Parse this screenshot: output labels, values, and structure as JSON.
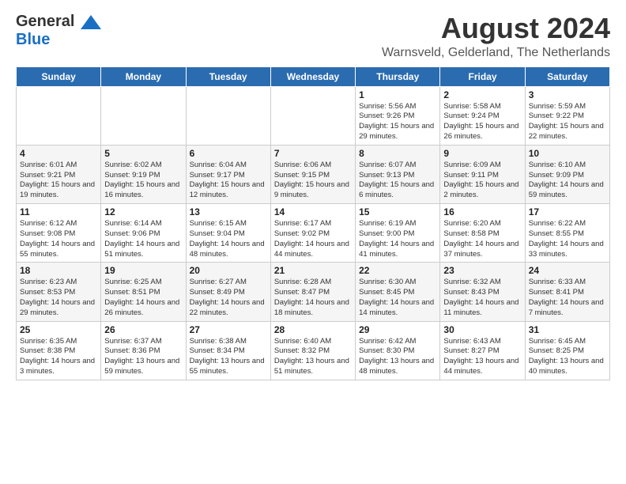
{
  "header": {
    "logo_line1": "General",
    "logo_line2": "Blue",
    "title": "August 2024",
    "subtitle": "Warnsveld, Gelderland, The Netherlands"
  },
  "days_of_week": [
    "Sunday",
    "Monday",
    "Tuesday",
    "Wednesday",
    "Thursday",
    "Friday",
    "Saturday"
  ],
  "weeks": [
    [
      {
        "day": "",
        "info": ""
      },
      {
        "day": "",
        "info": ""
      },
      {
        "day": "",
        "info": ""
      },
      {
        "day": "",
        "info": ""
      },
      {
        "day": "1",
        "info": "Sunrise: 5:56 AM\nSunset: 9:26 PM\nDaylight: 15 hours and 29 minutes."
      },
      {
        "day": "2",
        "info": "Sunrise: 5:58 AM\nSunset: 9:24 PM\nDaylight: 15 hours and 26 minutes."
      },
      {
        "day": "3",
        "info": "Sunrise: 5:59 AM\nSunset: 9:22 PM\nDaylight: 15 hours and 22 minutes."
      }
    ],
    [
      {
        "day": "4",
        "info": "Sunrise: 6:01 AM\nSunset: 9:21 PM\nDaylight: 15 hours and 19 minutes."
      },
      {
        "day": "5",
        "info": "Sunrise: 6:02 AM\nSunset: 9:19 PM\nDaylight: 15 hours and 16 minutes."
      },
      {
        "day": "6",
        "info": "Sunrise: 6:04 AM\nSunset: 9:17 PM\nDaylight: 15 hours and 12 minutes."
      },
      {
        "day": "7",
        "info": "Sunrise: 6:06 AM\nSunset: 9:15 PM\nDaylight: 15 hours and 9 minutes."
      },
      {
        "day": "8",
        "info": "Sunrise: 6:07 AM\nSunset: 9:13 PM\nDaylight: 15 hours and 6 minutes."
      },
      {
        "day": "9",
        "info": "Sunrise: 6:09 AM\nSunset: 9:11 PM\nDaylight: 15 hours and 2 minutes."
      },
      {
        "day": "10",
        "info": "Sunrise: 6:10 AM\nSunset: 9:09 PM\nDaylight: 14 hours and 59 minutes."
      }
    ],
    [
      {
        "day": "11",
        "info": "Sunrise: 6:12 AM\nSunset: 9:08 PM\nDaylight: 14 hours and 55 minutes."
      },
      {
        "day": "12",
        "info": "Sunrise: 6:14 AM\nSunset: 9:06 PM\nDaylight: 14 hours and 51 minutes."
      },
      {
        "day": "13",
        "info": "Sunrise: 6:15 AM\nSunset: 9:04 PM\nDaylight: 14 hours and 48 minutes."
      },
      {
        "day": "14",
        "info": "Sunrise: 6:17 AM\nSunset: 9:02 PM\nDaylight: 14 hours and 44 minutes."
      },
      {
        "day": "15",
        "info": "Sunrise: 6:19 AM\nSunset: 9:00 PM\nDaylight: 14 hours and 41 minutes."
      },
      {
        "day": "16",
        "info": "Sunrise: 6:20 AM\nSunset: 8:58 PM\nDaylight: 14 hours and 37 minutes."
      },
      {
        "day": "17",
        "info": "Sunrise: 6:22 AM\nSunset: 8:55 PM\nDaylight: 14 hours and 33 minutes."
      }
    ],
    [
      {
        "day": "18",
        "info": "Sunrise: 6:23 AM\nSunset: 8:53 PM\nDaylight: 14 hours and 29 minutes."
      },
      {
        "day": "19",
        "info": "Sunrise: 6:25 AM\nSunset: 8:51 PM\nDaylight: 14 hours and 26 minutes."
      },
      {
        "day": "20",
        "info": "Sunrise: 6:27 AM\nSunset: 8:49 PM\nDaylight: 14 hours and 22 minutes."
      },
      {
        "day": "21",
        "info": "Sunrise: 6:28 AM\nSunset: 8:47 PM\nDaylight: 14 hours and 18 minutes."
      },
      {
        "day": "22",
        "info": "Sunrise: 6:30 AM\nSunset: 8:45 PM\nDaylight: 14 hours and 14 minutes."
      },
      {
        "day": "23",
        "info": "Sunrise: 6:32 AM\nSunset: 8:43 PM\nDaylight: 14 hours and 11 minutes."
      },
      {
        "day": "24",
        "info": "Sunrise: 6:33 AM\nSunset: 8:41 PM\nDaylight: 14 hours and 7 minutes."
      }
    ],
    [
      {
        "day": "25",
        "info": "Sunrise: 6:35 AM\nSunset: 8:38 PM\nDaylight: 14 hours and 3 minutes."
      },
      {
        "day": "26",
        "info": "Sunrise: 6:37 AM\nSunset: 8:36 PM\nDaylight: 13 hours and 59 minutes."
      },
      {
        "day": "27",
        "info": "Sunrise: 6:38 AM\nSunset: 8:34 PM\nDaylight: 13 hours and 55 minutes."
      },
      {
        "day": "28",
        "info": "Sunrise: 6:40 AM\nSunset: 8:32 PM\nDaylight: 13 hours and 51 minutes."
      },
      {
        "day": "29",
        "info": "Sunrise: 6:42 AM\nSunset: 8:30 PM\nDaylight: 13 hours and 48 minutes."
      },
      {
        "day": "30",
        "info": "Sunrise: 6:43 AM\nSunset: 8:27 PM\nDaylight: 13 hours and 44 minutes."
      },
      {
        "day": "31",
        "info": "Sunrise: 6:45 AM\nSunset: 8:25 PM\nDaylight: 13 hours and 40 minutes."
      }
    ]
  ]
}
